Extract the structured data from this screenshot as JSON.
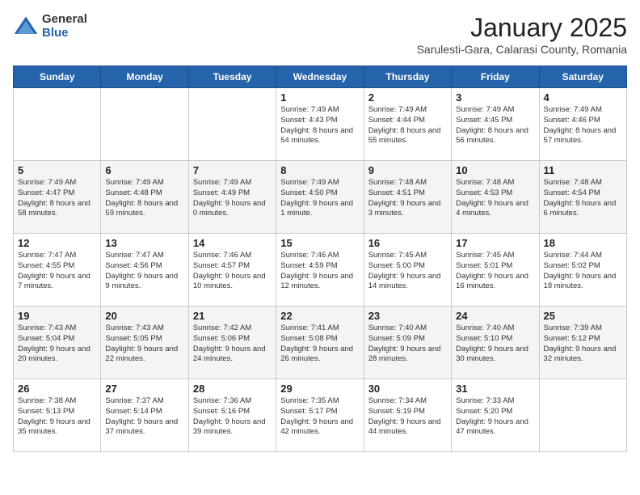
{
  "header": {
    "logo_general": "General",
    "logo_blue": "Blue",
    "title": "January 2025",
    "subtitle": "Sarulesti-Gara, Calarasi County, Romania"
  },
  "weekdays": [
    "Sunday",
    "Monday",
    "Tuesday",
    "Wednesday",
    "Thursday",
    "Friday",
    "Saturday"
  ],
  "weeks": [
    [
      {
        "day": "",
        "info": ""
      },
      {
        "day": "",
        "info": ""
      },
      {
        "day": "",
        "info": ""
      },
      {
        "day": "1",
        "info": "Sunrise: 7:49 AM\nSunset: 4:43 PM\nDaylight: 8 hours\nand 54 minutes."
      },
      {
        "day": "2",
        "info": "Sunrise: 7:49 AM\nSunset: 4:44 PM\nDaylight: 8 hours\nand 55 minutes."
      },
      {
        "day": "3",
        "info": "Sunrise: 7:49 AM\nSunset: 4:45 PM\nDaylight: 8 hours\nand 56 minutes."
      },
      {
        "day": "4",
        "info": "Sunrise: 7:49 AM\nSunset: 4:46 PM\nDaylight: 8 hours\nand 57 minutes."
      }
    ],
    [
      {
        "day": "5",
        "info": "Sunrise: 7:49 AM\nSunset: 4:47 PM\nDaylight: 8 hours\nand 58 minutes."
      },
      {
        "day": "6",
        "info": "Sunrise: 7:49 AM\nSunset: 4:48 PM\nDaylight: 8 hours\nand 59 minutes."
      },
      {
        "day": "7",
        "info": "Sunrise: 7:49 AM\nSunset: 4:49 PM\nDaylight: 9 hours\nand 0 minutes."
      },
      {
        "day": "8",
        "info": "Sunrise: 7:49 AM\nSunset: 4:50 PM\nDaylight: 9 hours\nand 1 minute."
      },
      {
        "day": "9",
        "info": "Sunrise: 7:48 AM\nSunset: 4:51 PM\nDaylight: 9 hours\nand 3 minutes."
      },
      {
        "day": "10",
        "info": "Sunrise: 7:48 AM\nSunset: 4:53 PM\nDaylight: 9 hours\nand 4 minutes."
      },
      {
        "day": "11",
        "info": "Sunrise: 7:48 AM\nSunset: 4:54 PM\nDaylight: 9 hours\nand 6 minutes."
      }
    ],
    [
      {
        "day": "12",
        "info": "Sunrise: 7:47 AM\nSunset: 4:55 PM\nDaylight: 9 hours\nand 7 minutes."
      },
      {
        "day": "13",
        "info": "Sunrise: 7:47 AM\nSunset: 4:56 PM\nDaylight: 9 hours\nand 9 minutes."
      },
      {
        "day": "14",
        "info": "Sunrise: 7:46 AM\nSunset: 4:57 PM\nDaylight: 9 hours\nand 10 minutes."
      },
      {
        "day": "15",
        "info": "Sunrise: 7:46 AM\nSunset: 4:59 PM\nDaylight: 9 hours\nand 12 minutes."
      },
      {
        "day": "16",
        "info": "Sunrise: 7:45 AM\nSunset: 5:00 PM\nDaylight: 9 hours\nand 14 minutes."
      },
      {
        "day": "17",
        "info": "Sunrise: 7:45 AM\nSunset: 5:01 PM\nDaylight: 9 hours\nand 16 minutes."
      },
      {
        "day": "18",
        "info": "Sunrise: 7:44 AM\nSunset: 5:02 PM\nDaylight: 9 hours\nand 18 minutes."
      }
    ],
    [
      {
        "day": "19",
        "info": "Sunrise: 7:43 AM\nSunset: 5:04 PM\nDaylight: 9 hours\nand 20 minutes."
      },
      {
        "day": "20",
        "info": "Sunrise: 7:43 AM\nSunset: 5:05 PM\nDaylight: 9 hours\nand 22 minutes."
      },
      {
        "day": "21",
        "info": "Sunrise: 7:42 AM\nSunset: 5:06 PM\nDaylight: 9 hours\nand 24 minutes."
      },
      {
        "day": "22",
        "info": "Sunrise: 7:41 AM\nSunset: 5:08 PM\nDaylight: 9 hours\nand 26 minutes."
      },
      {
        "day": "23",
        "info": "Sunrise: 7:40 AM\nSunset: 5:09 PM\nDaylight: 9 hours\nand 28 minutes."
      },
      {
        "day": "24",
        "info": "Sunrise: 7:40 AM\nSunset: 5:10 PM\nDaylight: 9 hours\nand 30 minutes."
      },
      {
        "day": "25",
        "info": "Sunrise: 7:39 AM\nSunset: 5:12 PM\nDaylight: 9 hours\nand 32 minutes."
      }
    ],
    [
      {
        "day": "26",
        "info": "Sunrise: 7:38 AM\nSunset: 5:13 PM\nDaylight: 9 hours\nand 35 minutes."
      },
      {
        "day": "27",
        "info": "Sunrise: 7:37 AM\nSunset: 5:14 PM\nDaylight: 9 hours\nand 37 minutes."
      },
      {
        "day": "28",
        "info": "Sunrise: 7:36 AM\nSunset: 5:16 PM\nDaylight: 9 hours\nand 39 minutes."
      },
      {
        "day": "29",
        "info": "Sunrise: 7:35 AM\nSunset: 5:17 PM\nDaylight: 9 hours\nand 42 minutes."
      },
      {
        "day": "30",
        "info": "Sunrise: 7:34 AM\nSunset: 5:19 PM\nDaylight: 9 hours\nand 44 minutes."
      },
      {
        "day": "31",
        "info": "Sunrise: 7:33 AM\nSunset: 5:20 PM\nDaylight: 9 hours\nand 47 minutes."
      },
      {
        "day": "",
        "info": ""
      }
    ]
  ]
}
